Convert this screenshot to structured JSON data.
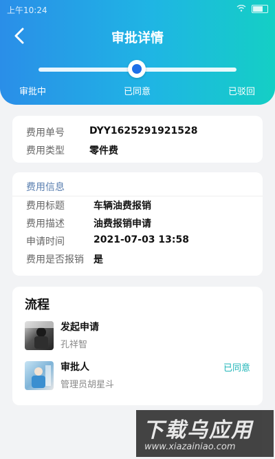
{
  "status_bar": {
    "time": "上午10:24"
  },
  "header": {
    "title": "审批详情",
    "steps": [
      "审批中",
      "已同意",
      "已驳回"
    ],
    "current_step_index": 1
  },
  "basic_info": {
    "fields": [
      {
        "key": "费用单号",
        "value": "DYY1625291921528"
      },
      {
        "key": "费用类型",
        "value": "零件费"
      }
    ]
  },
  "cost_info": {
    "section_title": "费用信息",
    "fields": [
      {
        "key": "费用标题",
        "value": "车辆油费报销"
      },
      {
        "key": "费用描述",
        "value": "油费报销申请"
      },
      {
        "key": "申请时间",
        "value": "2021-07-03 13:58"
      },
      {
        "key": "费用是否报销",
        "value": "是"
      }
    ]
  },
  "flow": {
    "title": "流程",
    "items": [
      {
        "name": "发起申请",
        "sub": "孔祥智",
        "status": ""
      },
      {
        "name": "审批人",
        "sub": "管理员胡星斗",
        "status": "已同意"
      }
    ]
  },
  "watermark": {
    "main": "下载乌应用",
    "sub": "www.xiazainiao.com"
  },
  "colors": {
    "accent": "#1e6fe8",
    "approved": "#1fb5b8",
    "section": "#5a7fb0"
  }
}
